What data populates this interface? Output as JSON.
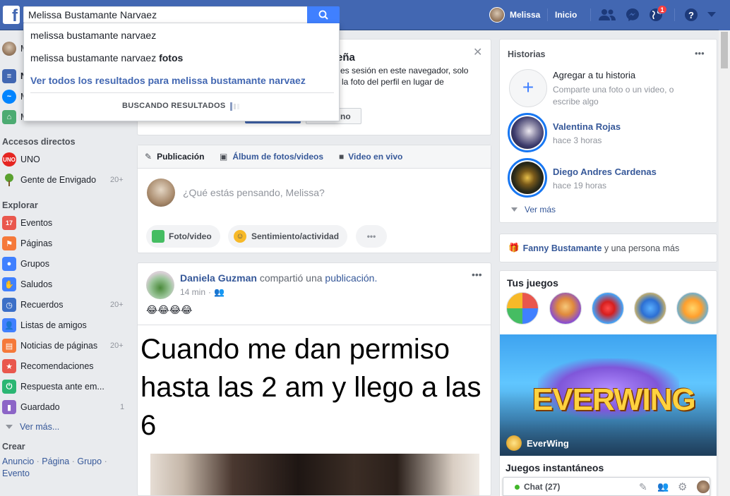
{
  "header": {
    "search_value": "Melissa Bustamante Narvaez",
    "user_name": "Melissa",
    "home_label": "Inicio",
    "notification_count": "1"
  },
  "search_dropdown": {
    "suggestions": [
      {
        "text": "melissa bustamante narvaez",
        "bold_suffix": ""
      },
      {
        "text": "melissa bustamante narvaez ",
        "bold_suffix": "fotos"
      }
    ],
    "see_all": "Ver todos los resultados para melissa bustamante narvaez",
    "loading": "BUSCANDO RESULTADOS"
  },
  "left_sidebar": {
    "profile_initial": "M",
    "shortcuts_title": "Accesos directos",
    "shortcuts": [
      {
        "label": "UNO",
        "count": ""
      },
      {
        "label": "Gente de Envigado",
        "count": "20+"
      }
    ],
    "explore_title": "Explorar",
    "explore": [
      {
        "label": "Eventos",
        "count": "",
        "icon": "calendar-icon",
        "color": "#e9574d"
      },
      {
        "label": "Páginas",
        "count": "",
        "icon": "flag-icon",
        "color": "#f5793a"
      },
      {
        "label": "Grupos",
        "count": "",
        "icon": "groups-icon",
        "color": "#4080ff"
      },
      {
        "label": "Saludos",
        "count": "",
        "icon": "wave-icon",
        "color": "#4080ff"
      },
      {
        "label": "Recuerdos",
        "count": "20+",
        "icon": "memories-icon",
        "color": "#3b6fc7"
      },
      {
        "label": "Listas de amigos",
        "count": "",
        "icon": "friends-list-icon",
        "color": "#4080ff"
      },
      {
        "label": "Noticias de páginas",
        "count": "20+",
        "icon": "page-feed-icon",
        "color": "#f5793a"
      },
      {
        "label": "Recomendaciones",
        "count": "",
        "icon": "recommendations-icon",
        "color": "#e9574d"
      },
      {
        "label": "Respuesta ante em...",
        "count": "",
        "icon": "crisis-icon",
        "color": "#2bb673"
      },
      {
        "label": "Guardado",
        "count": "1",
        "icon": "bookmark-icon",
        "color": "#8c65c7"
      }
    ],
    "see_more": "Ver más...",
    "create_title": "Crear",
    "create_links": [
      "Anuncio",
      "Página",
      "Grupo",
      "Evento"
    ]
  },
  "security_card": {
    "title_tail": "eña",
    "line1": "es sesión en este navegador, solo",
    "line2": "la foto del perfil en lugar de",
    "button_no": "no"
  },
  "composer": {
    "tabs": [
      "Publicación",
      "Álbum de fotos/videos",
      "Video en vivo"
    ],
    "placeholder": "¿Qué estás pensando, Melissa?",
    "actions": [
      "Foto/video",
      "Sentimiento/actividad"
    ]
  },
  "post": {
    "author": "Daniela Guzman",
    "action_text": "compartió una",
    "action_link": "publicación.",
    "time": "14 min",
    "emojis": "😂😂😂😂",
    "meme_text": "Cuando me dan permiso hasta las 2 am y llego a las 6"
  },
  "stories": {
    "title": "Historias",
    "add_title": "Agregar a tu historia",
    "add_sub": "Comparte una foto o un video, o escribe algo",
    "items": [
      {
        "name": "Valentina Rojas",
        "time": "hace 3 horas"
      },
      {
        "name": "Diego Andres Cardenas",
        "time": "hace 19 horas"
      }
    ],
    "see_more": "Ver más"
  },
  "birthday": {
    "name": "Fanny Bustamante",
    "rest": "y una persona más"
  },
  "games": {
    "title": "Tus juegos",
    "featured_name": "EverWing",
    "featured_logo": "EVERWING",
    "instant_title": "Juegos instantáneos"
  },
  "chat": {
    "label": "Chat (27)"
  }
}
